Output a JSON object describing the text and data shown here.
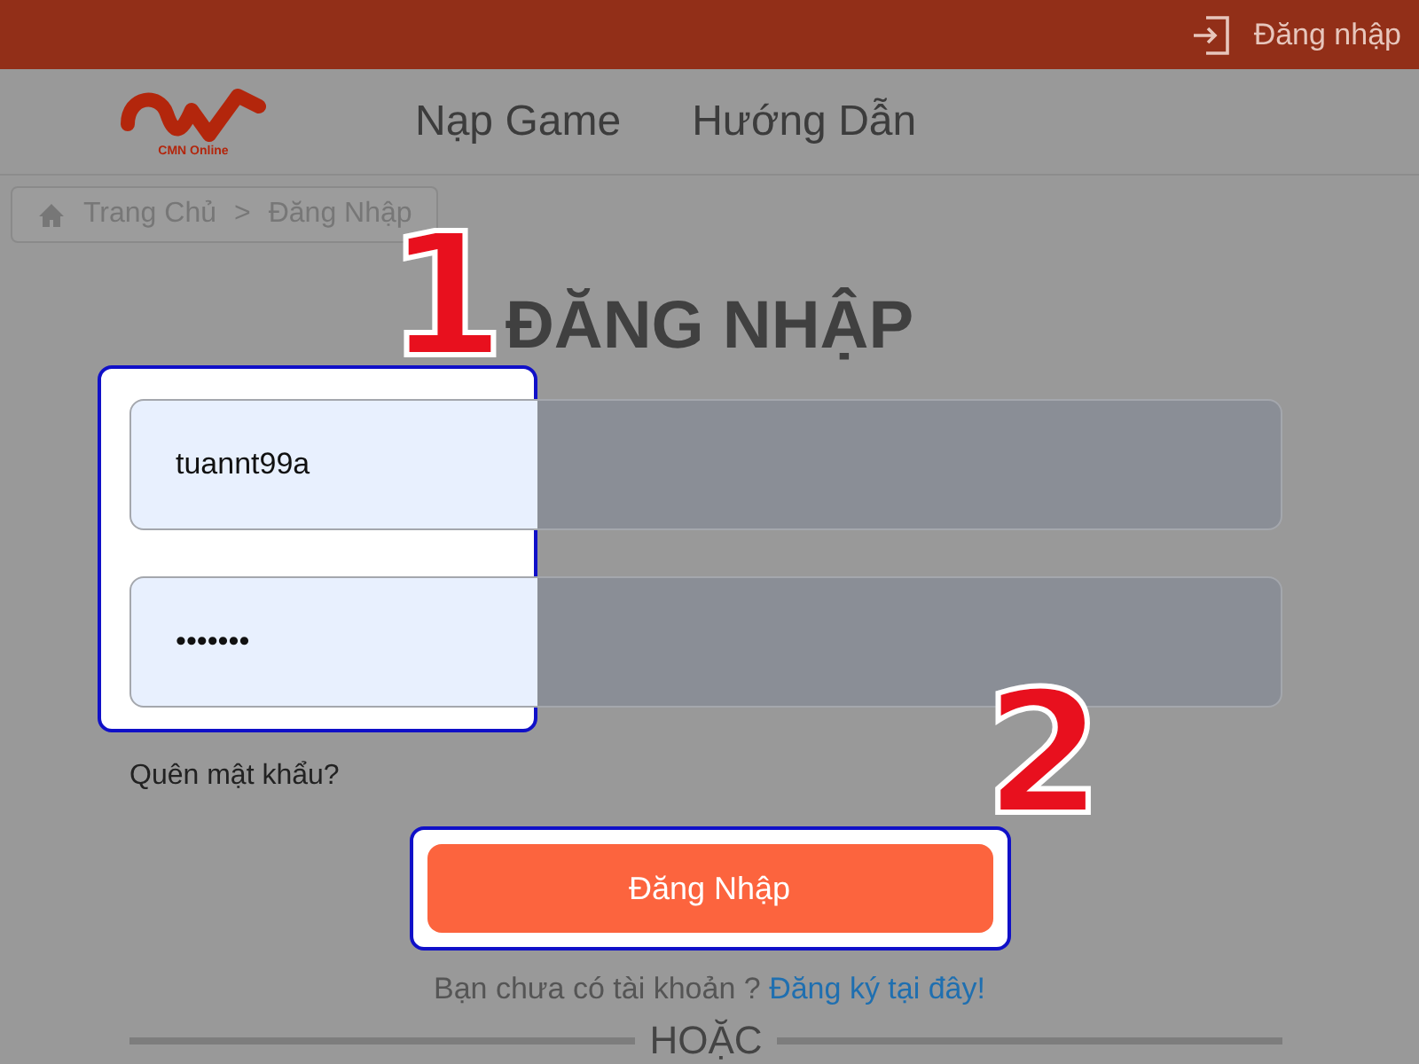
{
  "top_bar": {
    "login_link": "Đăng nhập"
  },
  "header": {
    "logo_caption": "CMN Online",
    "nav": [
      {
        "label": "Nạp Game"
      },
      {
        "label": "Hướng Dẫn"
      }
    ]
  },
  "breadcrumb": {
    "items": [
      "Trang Chủ",
      "Đăng Nhập"
    ],
    "separator": ">"
  },
  "form": {
    "title": "ĐĂNG NHẬP",
    "username": {
      "value": "tuannt99a"
    },
    "password": {
      "value": "•••••••"
    },
    "forgot_link": "Quên mật khẩu?",
    "submit": "Đăng Nhập",
    "signup_prompt": "Bạn chưa có tài khoản ?",
    "signup_link": "Đăng ký tại đây!",
    "divider_label": "HOẶC"
  },
  "annotations": [
    {
      "label": "1"
    },
    {
      "label": "2"
    }
  ]
}
